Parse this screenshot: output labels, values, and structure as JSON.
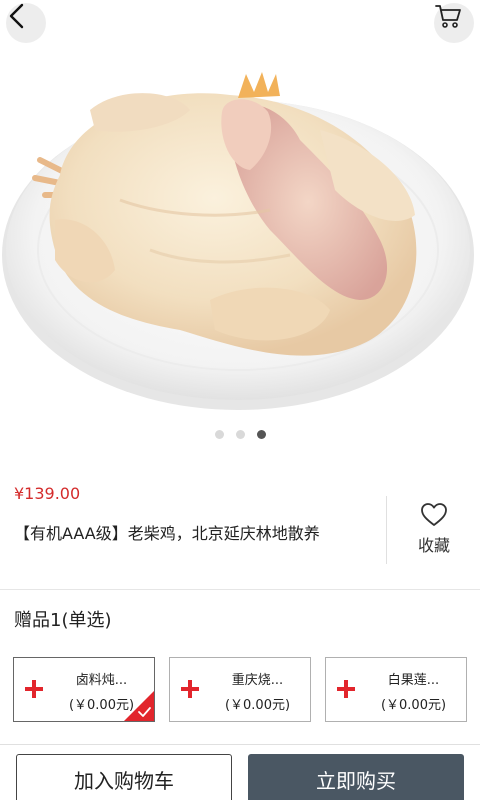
{
  "hero": {
    "image_alt": "whole raw chicken on a white plate",
    "carousel": {
      "count": 3,
      "active_index": 2
    }
  },
  "nav": {
    "back_icon": "chevron-left-icon",
    "cart_icon": "cart-icon"
  },
  "product": {
    "price": "¥139.00",
    "title": "【有机AAA级】老柴鸡，北京延庆林地散养",
    "favorite_label": "收藏",
    "favorite_icon": "heart-outline-icon"
  },
  "gifts": {
    "heading": "赠品1(单选)",
    "items": [
      {
        "name": "卤料炖...",
        "price": "(￥0.00元)",
        "selected": true
      },
      {
        "name": "重庆烧...",
        "price": "(￥0.00元)",
        "selected": false
      },
      {
        "name": "白果莲...",
        "price": "(￥0.00元)",
        "selected": false
      }
    ]
  },
  "actions": {
    "add_to_cart": "加入购物车",
    "buy_now": "立即购买"
  },
  "colors": {
    "price_red": "#d42b2b",
    "plus_red": "#e2252c",
    "buy_button": "#4a5763"
  }
}
